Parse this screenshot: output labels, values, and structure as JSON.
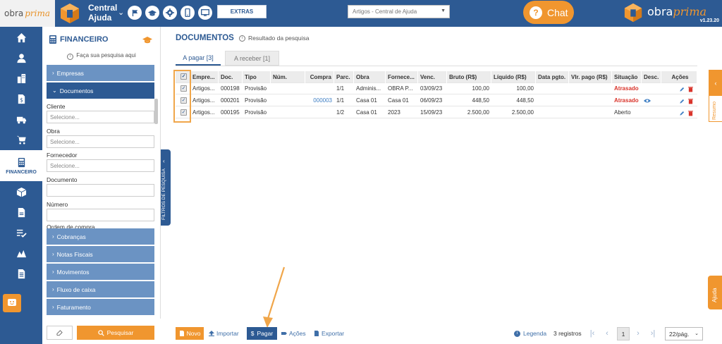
{
  "topbar": {
    "logo_obra": "obra",
    "logo_prima": "prima",
    "project_title": "Central Ajuda",
    "extras_label": "EXTRAS",
    "search_select_value": "Artigos - Central de Ajuda",
    "chat_label": "Chat",
    "brand_obra": "obra",
    "brand_prima": "prima",
    "version": "v1.23.20",
    "icons": [
      "flag-icon",
      "graduation-cap-icon",
      "gear-icon",
      "phone-icon",
      "monitor-icon"
    ]
  },
  "leftnav": {
    "items": [
      "home-icon",
      "user-icon",
      "building-icon",
      "dollar-doc-icon",
      "truck-icon",
      "cart-icon",
      "calculator-icon",
      "box-icon",
      "doc-icon",
      "checklist-icon",
      "chart-icon",
      "file-icon"
    ],
    "active_label": "FINANCEIRO"
  },
  "panel": {
    "title": "FINANCEIRO",
    "hint": "Faça sua pesquisa aqui",
    "sections_top": [
      "Empresas",
      "Documentos"
    ],
    "fields": [
      {
        "label": "Cliente",
        "placeholder": "Selecione..."
      },
      {
        "label": "Obra",
        "placeholder": "Selecione..."
      },
      {
        "label": "Fornecedor",
        "placeholder": "Selecione..."
      },
      {
        "label": "Documento",
        "placeholder": ""
      },
      {
        "label": "Número",
        "placeholder": ""
      }
    ],
    "partial_label": "Ordem de compra",
    "sections_bottom": [
      "Cobranças",
      "Notas Fiscais",
      "Movimentos",
      "Fluxo de caixa",
      "Faturamento"
    ],
    "search_button": "Pesquisar",
    "filter_tab": "FILTROS DE PESQUISA"
  },
  "main": {
    "title": "DOCUMENTOS",
    "subtitle": "Resultado da pesquisa",
    "tabs": [
      "A pagar [3]",
      "A receber [1]"
    ],
    "columns": [
      "Empre...",
      "Doc.",
      "Tipo",
      "Núm.",
      "Compra",
      "Parc.",
      "Obra",
      "Fornece...",
      "Venc.",
      "Bruto (R$)",
      "Líquido (R$)",
      "Data pgto.",
      "Vlr. pago (R$)",
      "Situação",
      "Desc.",
      "Ações"
    ],
    "rows": [
      {
        "empresa": "Artigos...",
        "doc": "000198",
        "tipo": "Provisão",
        "num": "",
        "compra": "",
        "parc": "1/1",
        "obra": "Adminis...",
        "fornecedor": "OBRA P...",
        "venc": "03/09/23",
        "bruto": "100,00",
        "liquido": "100,00",
        "data_pgto": "",
        "vlr_pago": "",
        "situacao": "Atrasado",
        "desc": false
      },
      {
        "empresa": "Artigos...",
        "doc": "000201",
        "tipo": "Provisão",
        "num": "",
        "compra": "000003",
        "parc": "1/1",
        "obra": "Casa 01",
        "fornecedor": "Casa 01",
        "venc": "06/09/23",
        "bruto": "448,50",
        "liquido": "448,50",
        "data_pgto": "",
        "vlr_pago": "",
        "situacao": "Atrasado",
        "desc": true
      },
      {
        "empresa": "Artigos...",
        "doc": "000195",
        "tipo": "Provisão",
        "num": "",
        "compra": "",
        "parc": "1/2",
        "obra": "Casa 01",
        "fornecedor": "2023",
        "venc": "15/09/23",
        "bruto": "2.500,00",
        "liquido": "2.500,00",
        "data_pgto": "",
        "vlr_pago": "",
        "situacao": "Aberto",
        "desc": false
      }
    ]
  },
  "right": {
    "resumo": "Resumo",
    "ajuda": "Ajuda"
  },
  "toolbar": {
    "novo": "Novo",
    "importar": "Importar",
    "pagar": "Pagar",
    "acoes": "Ações",
    "exportar": "Exportar",
    "legenda": "Legenda",
    "registros": "3 registros",
    "current_page": "1",
    "per_page": "22/pág."
  },
  "colors": {
    "primary": "#2d5a93",
    "accent": "#f0962f",
    "alert": "#d9342b"
  }
}
